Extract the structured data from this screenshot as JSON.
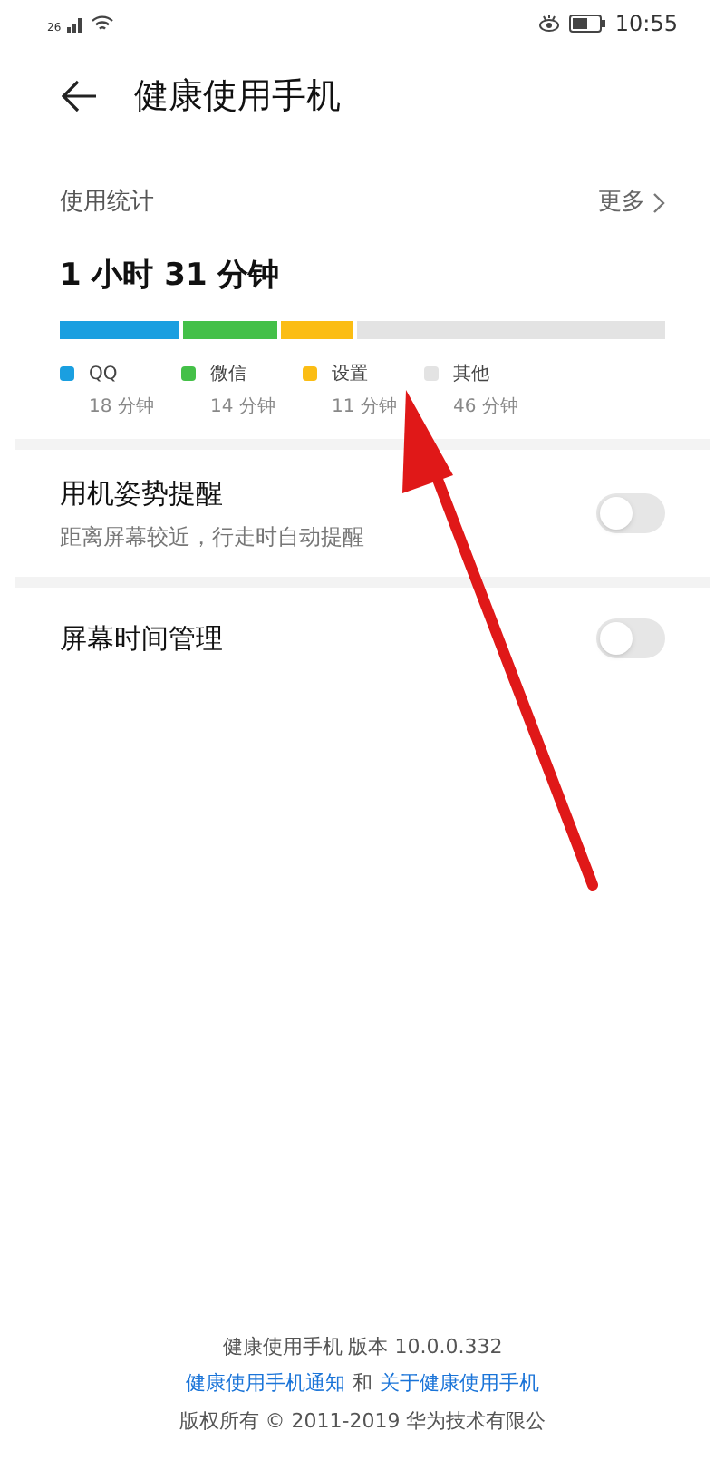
{
  "status_bar": {
    "network": "26",
    "time": "10:55"
  },
  "header": {
    "title": "健康使用手机"
  },
  "usage": {
    "title": "使用统计",
    "more": "更多",
    "total": "1 小时 31 分钟",
    "apps": [
      {
        "name": "QQ",
        "time": "18 分钟",
        "color": "#1a9fe0"
      },
      {
        "name": "微信",
        "time": "14 分钟",
        "color": "#44c048"
      },
      {
        "name": "设置",
        "time": "11 分钟",
        "color": "#fbbd14"
      },
      {
        "name": "其他",
        "time": "46 分钟",
        "color": "#e3e3e3"
      }
    ]
  },
  "settings": [
    {
      "title": "用机姿势提醒",
      "subtitle": "距离屏幕较近，行走时自动提醒",
      "on": false
    },
    {
      "title": "屏幕时间管理",
      "on": false
    }
  ],
  "footer": {
    "version": "健康使用手机 版本 10.0.0.332",
    "link_1": "健康使用手机通知",
    "conjunction": "和",
    "link_2": "关于健康使用手机",
    "copyright": "版权所有 © 2011-2019 华为技术有限公"
  }
}
